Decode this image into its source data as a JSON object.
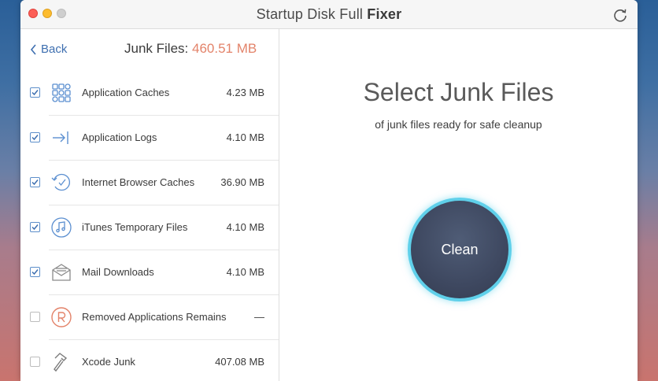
{
  "window": {
    "title_regular": "Startup Disk Full ",
    "title_bold": "Fixer"
  },
  "nav": {
    "back_label": "Back"
  },
  "junk": {
    "title_label": "Junk Files: ",
    "total_size": "460.51 MB"
  },
  "items": [
    {
      "label": "Application Caches",
      "size": "4.23 MB",
      "checked": true,
      "icon": "grid-apps-icon"
    },
    {
      "label": "Application Logs",
      "size": "4.10 MB",
      "checked": true,
      "icon": "log-arrow-icon"
    },
    {
      "label": "Internet Browser Caches",
      "size": "36.90 MB",
      "checked": true,
      "icon": "clock-history-icon"
    },
    {
      "label": "iTunes Temporary Files",
      "size": "4.10 MB",
      "checked": true,
      "icon": "music-note-icon"
    },
    {
      "label": "Mail Downloads",
      "size": "4.10 MB",
      "checked": true,
      "icon": "envelope-icon"
    },
    {
      "label": "Removed Applications Remains",
      "size": "—",
      "checked": false,
      "icon": "r-circle-icon"
    },
    {
      "label": "Xcode Junk",
      "size": "407.08 MB",
      "checked": false,
      "icon": "hammer-icon"
    }
  ],
  "main": {
    "heading": "Select Junk Files",
    "subtitle": "of junk files ready for safe cleanup",
    "clean_label": "Clean"
  },
  "colors": {
    "accent": "#3e6fb0",
    "size_highlight": "#e3836a",
    "ring": "#5fd0ea",
    "button": "#3e4860"
  }
}
